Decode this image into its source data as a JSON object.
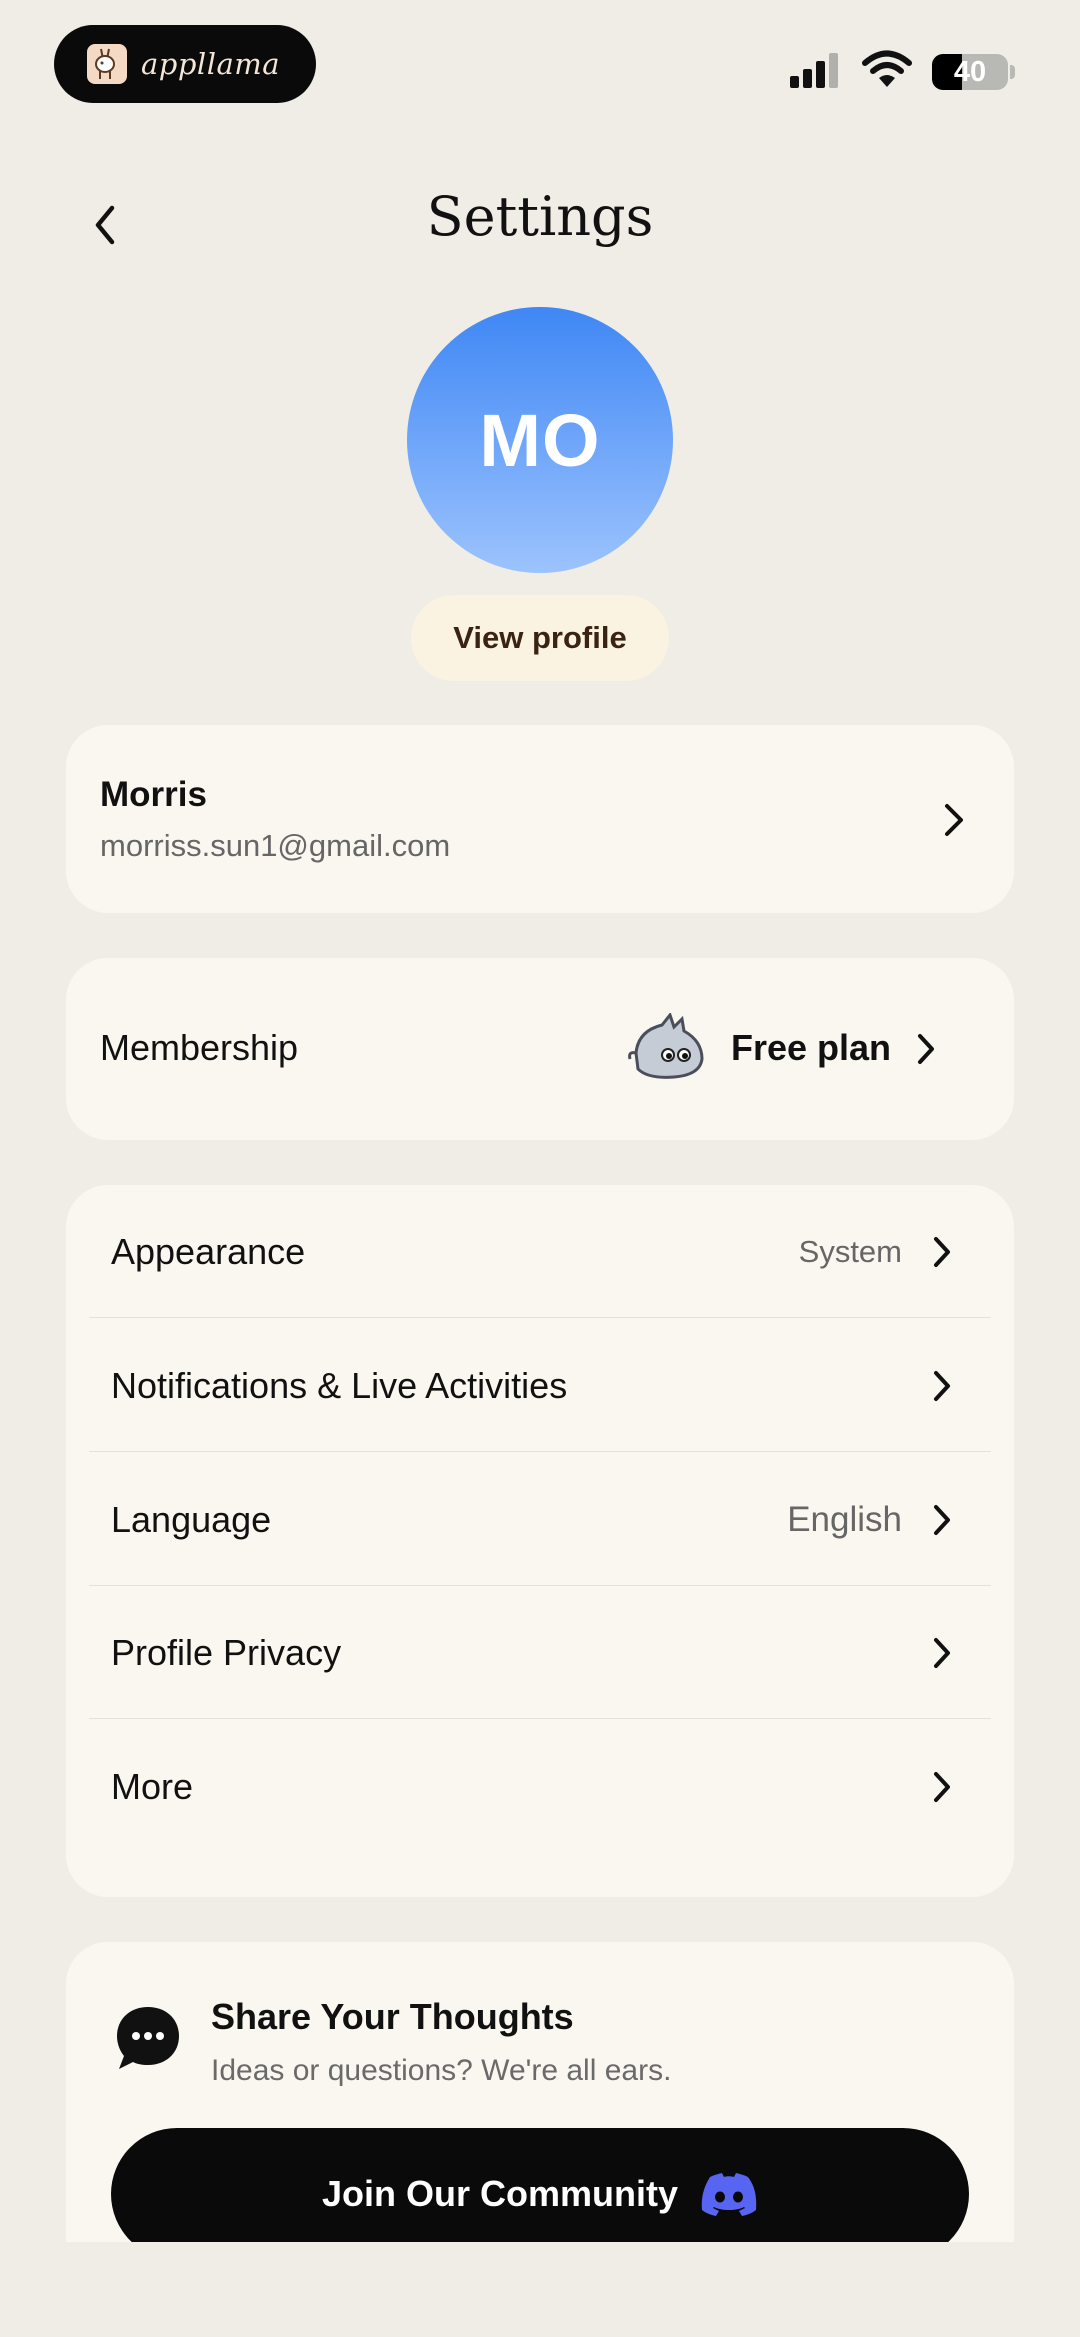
{
  "status_bar": {
    "app_name": "appllama",
    "battery": "40",
    "battery_level": 0.4
  },
  "header": {
    "title": "Settings",
    "back_icon": "chevron-left-icon"
  },
  "profile": {
    "initials": "MO",
    "view_profile_label": "View profile",
    "avatar_gradient": [
      "#3f87f5",
      "#9cc3fd"
    ]
  },
  "account": {
    "name": "Morris",
    "email": "morriss.sun1@gmail.com"
  },
  "membership": {
    "label": "Membership",
    "plan": "Free plan",
    "mascot_icon": "mascot-icon"
  },
  "settings": {
    "items": [
      {
        "label": "Appearance",
        "value": "System"
      },
      {
        "label": "Notifications & Live Activities",
        "value": ""
      },
      {
        "label": "Language",
        "value": "English"
      },
      {
        "label": "Profile Privacy",
        "value": ""
      },
      {
        "label": "More",
        "value": ""
      }
    ]
  },
  "community": {
    "title": "Share Your Thoughts",
    "subtitle": "Ideas or questions? We're all ears.",
    "button_label": "Join Our Community",
    "button_icon": "discord-icon",
    "accent": "#5865f2"
  }
}
